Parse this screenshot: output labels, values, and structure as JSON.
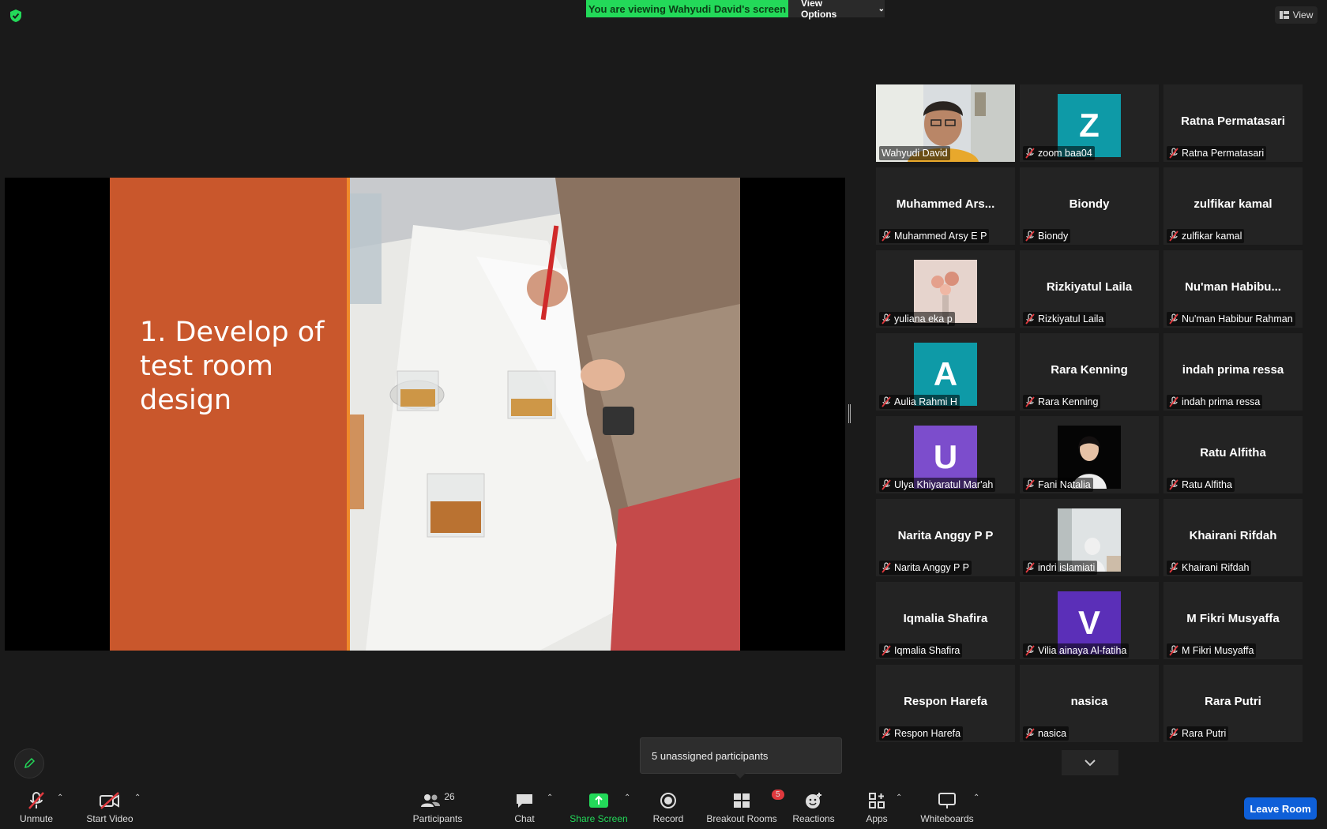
{
  "top": {
    "banner": "You are viewing Wahyudi David's screen",
    "view_options": "View Options",
    "view_label": "View"
  },
  "slide": {
    "title": "1. Develop of test room design"
  },
  "gallery": [
    {
      "name": "Wahyudi David",
      "display": "",
      "type": "video",
      "active": true,
      "muted": false
    },
    {
      "name": "zoom baa04",
      "display": "Z",
      "type": "letter",
      "color": "#0e9aa7"
    },
    {
      "name": "Ratna Permatasari",
      "display": "Ratna Permatasari",
      "type": "text"
    },
    {
      "name": "Muhammed Arsy E P",
      "display": "Muhammed Ars...",
      "type": "text"
    },
    {
      "name": "Biondy",
      "display": "Biondy",
      "type": "text"
    },
    {
      "name": "zulfikar kamal",
      "display": "zulfikar kamal",
      "type": "text"
    },
    {
      "name": "yuliana eka p",
      "display": "",
      "type": "photo-flowers"
    },
    {
      "name": "Rizkiyatul Laila",
      "display": "Rizkiyatul Laila",
      "type": "text"
    },
    {
      "name": "Nu'man Habibur Rahman",
      "display": "Nu'man  Habibu...",
      "type": "text"
    },
    {
      "name": "Aulia Rahmi H",
      "display": "A",
      "type": "letter",
      "color": "#0e9aa7"
    },
    {
      "name": "Rara Kenning",
      "display": "Rara Kenning",
      "type": "text"
    },
    {
      "name": "indah prima ressa",
      "display": "indah prima ressa",
      "type": "text"
    },
    {
      "name": "Ulya Khiyaratul Mar'ah",
      "display": "U",
      "type": "letter",
      "color": "#7c4dcc"
    },
    {
      "name": "Fani Natalia",
      "display": "",
      "type": "photo-portrait"
    },
    {
      "name": "Ratu Alfitha",
      "display": "Ratu Alfitha",
      "type": "text"
    },
    {
      "name": "Narita Anggy P P",
      "display": "Narita Anggy P P",
      "type": "text"
    },
    {
      "name": "indri islamiati",
      "display": "",
      "type": "photo-room"
    },
    {
      "name": "Khairani Rifdah",
      "display": "Khairani Rifdah",
      "type": "text"
    },
    {
      "name": "Iqmalia Shafira",
      "display": "Iqmalia Shafira",
      "type": "text"
    },
    {
      "name": "Vilia ainaya Al-fatiha",
      "display": "V",
      "type": "letter",
      "color": "#5b2fb8"
    },
    {
      "name": "M Fikri Musyaffa",
      "display": "M Fikri Musyaffa",
      "type": "text"
    },
    {
      "name": "Respon Harefa",
      "display": "Respon Harefa",
      "type": "text"
    },
    {
      "name": "nasica",
      "display": "nasica",
      "type": "text"
    },
    {
      "name": "Rara Putri",
      "display": "Rara Putri",
      "type": "text"
    }
  ],
  "toast": "5 unassigned participants",
  "toolbar": {
    "unmute": "Unmute",
    "start_video": "Start Video",
    "participants": "Participants",
    "participant_count": "26",
    "chat": "Chat",
    "share_screen": "Share Screen",
    "record": "Record",
    "breakout_rooms": "Breakout Rooms",
    "breakout_badge": "5",
    "reactions": "Reactions",
    "apps": "Apps",
    "whiteboards": "Whiteboards",
    "leave_room": "Leave Room"
  },
  "colors": {
    "banner_green": "#23d959",
    "leave_blue": "#0e5fd8",
    "slide_orange": "#c9572c",
    "active_speaker": "#d7f04a",
    "muted_red": "#e0393e"
  }
}
